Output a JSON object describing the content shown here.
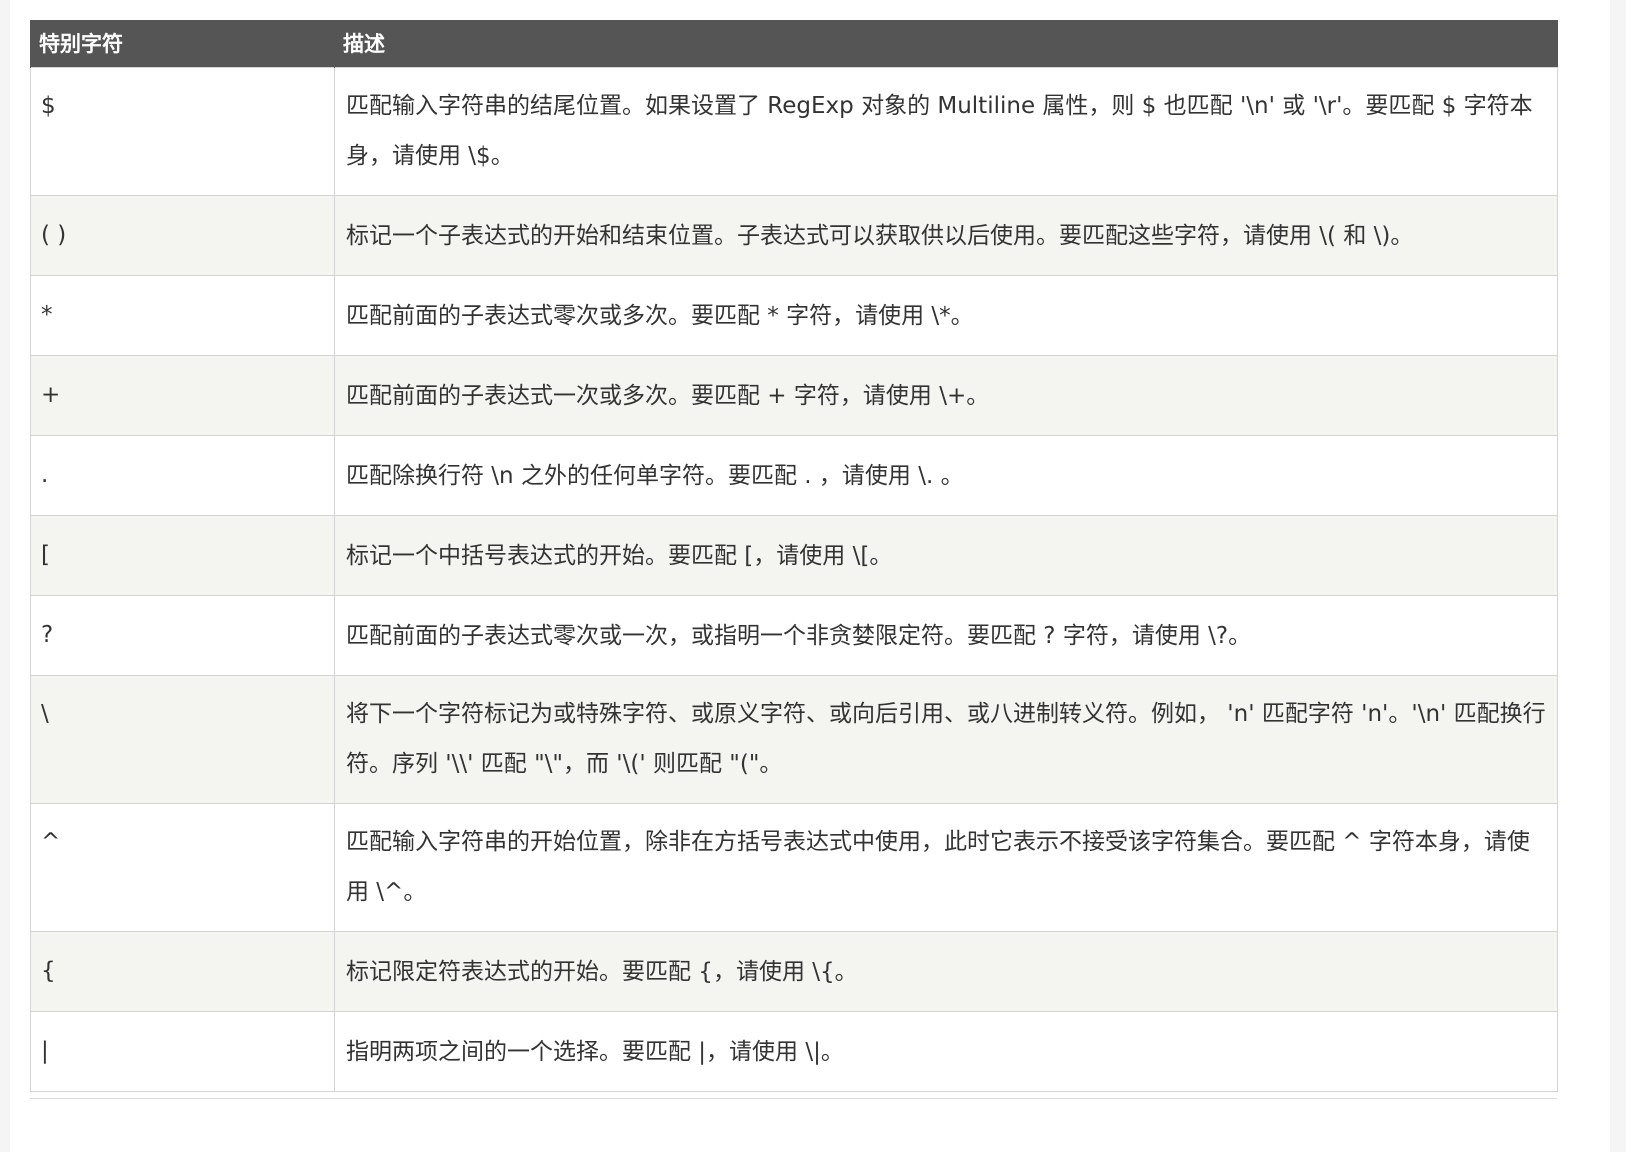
{
  "table": {
    "headers": [
      "特别字符",
      "描述"
    ],
    "rows": [
      {
        "char": "$",
        "desc": "匹配输入字符串的结尾位置。如果设置了 RegExp 对象的 Multiline 属性，则 $ 也匹配 '\\n' 或 '\\r'。要匹配 $ 字符本身，请使用 \\$。"
      },
      {
        "char": "( )",
        "desc": "标记一个子表达式的开始和结束位置。子表达式可以获取供以后使用。要匹配这些字符，请使用 \\( 和 \\)。"
      },
      {
        "char": "*",
        "desc": "匹配前面的子表达式零次或多次。要匹配 * 字符，请使用 \\*。"
      },
      {
        "char": "+",
        "desc": "匹配前面的子表达式一次或多次。要匹配 + 字符，请使用 \\+。"
      },
      {
        "char": ".",
        "desc": "匹配除换行符 \\n 之外的任何单字符。要匹配 . ，请使用 \\. 。"
      },
      {
        "char": "[",
        "desc": "标记一个中括号表达式的开始。要匹配 [，请使用 \\[。"
      },
      {
        "char": "?",
        "desc": "匹配前面的子表达式零次或一次，或指明一个非贪婪限定符。要匹配 ? 字符，请使用 \\?。"
      },
      {
        "char": "\\",
        "desc": "将下一个字符标记为或特殊字符、或原义字符、或向后引用、或八进制转义符。例如， 'n' 匹配字符 'n'。'\\n' 匹配换行符。序列 '\\\\' 匹配 \"\\\"，而 '\\(' 则匹配 \"(\"。"
      },
      {
        "char": "^",
        "desc": "匹配输入字符串的开始位置，除非在方括号表达式中使用，此时它表示不接受该字符集合。要匹配 ^ 字符本身，请使用 \\^。"
      },
      {
        "char": "{",
        "desc": "标记限定符表达式的开始。要匹配 {，请使用 \\{。"
      },
      {
        "char": "|",
        "desc": "指明两项之间的一个选择。要匹配 |，请使用 \\|。"
      }
    ]
  }
}
